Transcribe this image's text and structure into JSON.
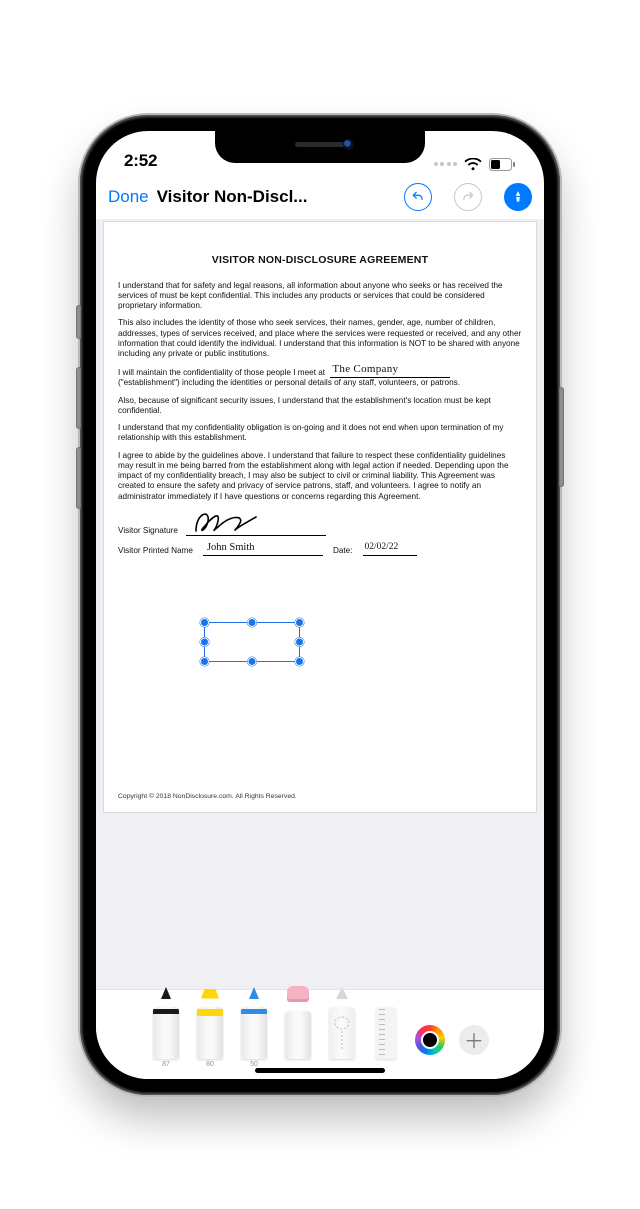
{
  "statusbar": {
    "time": "2:52"
  },
  "nav": {
    "done": "Done",
    "title": "Visitor Non-Discl..."
  },
  "tools": {
    "pen_label": "87",
    "highlighter_label": "80",
    "pencil_label": "50",
    "eraser_label": "",
    "lasso_label": "",
    "ruler_label": ""
  },
  "document": {
    "title": "VISITOR NON-DISCLOSURE AGREEMENT",
    "p1": "I understand that for safety and legal reasons, all information about anyone who seeks or has received the services of must be kept confidential. This includes any products or services that could be considered proprietary information.",
    "p2": "This also includes the identity of those who seek services, their names, gender, age, number of children, addresses, types of services received, and place where the services were requested or received, and any other information that could identify the individual. I understand that this information is NOT to be shared with anyone including any private or public institutions.",
    "p3a": "I will maintain the confidentiality of those people I meet at",
    "company_value": "The Company",
    "p3b": "(\"establishment\") including the identities or personal details of any staff, volunteers, or patrons.",
    "p4": "Also, because of significant security issues, I understand that the establishment's location must be kept confidential.",
    "p5": "I understand that my confidentiality obligation is on-going and it does not end when upon termination of my relationship with this establishment.",
    "p6": "I agree to abide by the guidelines above. I understand that failure to respect these confidentiality guidelines may result in me being barred from the establishment along with legal action if needed. Depending upon the impact of my confidentiality breach, I may also be subject to civil or criminal liability. This Agreement was created to ensure the safety and privacy of service patrons, staff, and volunteers.  I agree to notify an administrator immediately if I have questions or concerns regarding this Agreement.",
    "sig_label": "Visitor Signature",
    "printed_label": "Visitor Printed Name",
    "printed_value": "John Smith",
    "date_label": "Date:",
    "date_value": "02/02/22",
    "copyright": "Copyright © 2018 NonDisclosure.com. All Rights Reserved."
  }
}
